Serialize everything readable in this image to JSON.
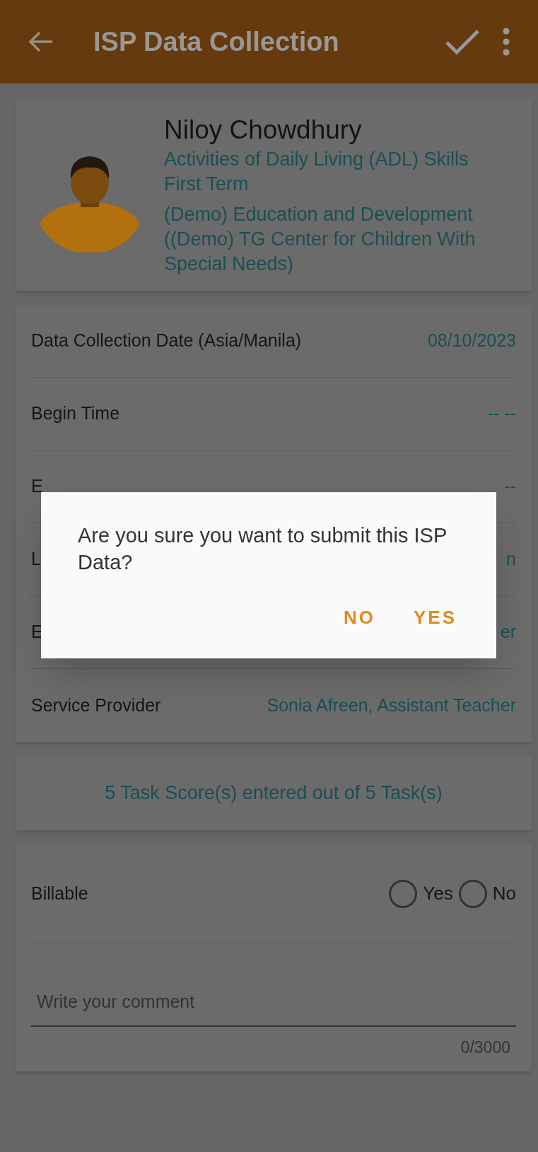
{
  "app_bar": {
    "title": "ISP Data Collection"
  },
  "profile": {
    "name": "Niloy Chowdhury",
    "lines": [
      "Activities of Daily Living (ADL) Skills",
      "First Term",
      "(Demo) Education and Development ((Demo) TG Center for Children With Special Needs)"
    ]
  },
  "details": [
    {
      "label": "Data Collection Date (Asia/Manila)",
      "value": "08/10/2023"
    },
    {
      "label": "Begin Time",
      "value": "-- --"
    },
    {
      "label": "E",
      "value": "--"
    },
    {
      "label": "L",
      "value": "n"
    },
    {
      "label": "E",
      "value": "er"
    },
    {
      "label": "Service Provider",
      "value": "Sonia Afreen, Assistant Teacher"
    }
  ],
  "task_summary": "5 Task Score(s) entered out of 5 Task(s)",
  "billable": {
    "label": "Billable",
    "options": [
      {
        "label": "Yes",
        "selected": false
      },
      {
        "label": "No",
        "selected": false
      }
    ]
  },
  "comment": {
    "placeholder": "Write your comment",
    "counter": "0/3000"
  },
  "dialog": {
    "message": "Are you sure you want to submit this ISP Data?",
    "buttons": [
      "NO",
      "YES"
    ]
  }
}
